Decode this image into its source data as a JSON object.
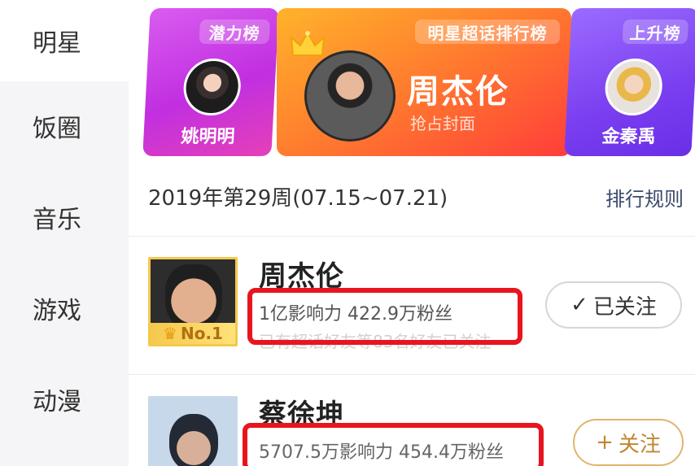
{
  "sidebar": {
    "items": [
      {
        "label": "明星",
        "active": true
      },
      {
        "label": "饭圈",
        "active": false
      },
      {
        "label": "音乐",
        "active": false
      },
      {
        "label": "游戏",
        "active": false
      },
      {
        "label": "动漫",
        "active": false
      }
    ]
  },
  "banner": {
    "left": {
      "tag": "潜力榜",
      "name": "姚明明"
    },
    "main": {
      "tag": "明星超话排行榜",
      "name": "周杰伦",
      "subtitle": "抢占封面"
    },
    "right": {
      "tag": "上升榜",
      "name": "金秦禹"
    }
  },
  "week": {
    "label": "2019年第29周(07.15~07.21)",
    "rules_link": "排行规则"
  },
  "ranking": [
    {
      "name": "周杰伦",
      "rank_badge": "No.1",
      "stats": "1亿影响力 422.9万粉丝",
      "extra": "已有超话好友等83名好友已关注",
      "button": {
        "label": "已关注",
        "icon": "check-icon"
      }
    },
    {
      "name": "蔡徐坤",
      "stats": "5707.5万影响力 454.4万粉丝",
      "button": {
        "label": "关注",
        "icon": "plus-icon"
      }
    }
  ],
  "colors": {
    "highlight": "#e8151e",
    "accent_gold": "#c0862e",
    "link": "#3a4a6b"
  }
}
